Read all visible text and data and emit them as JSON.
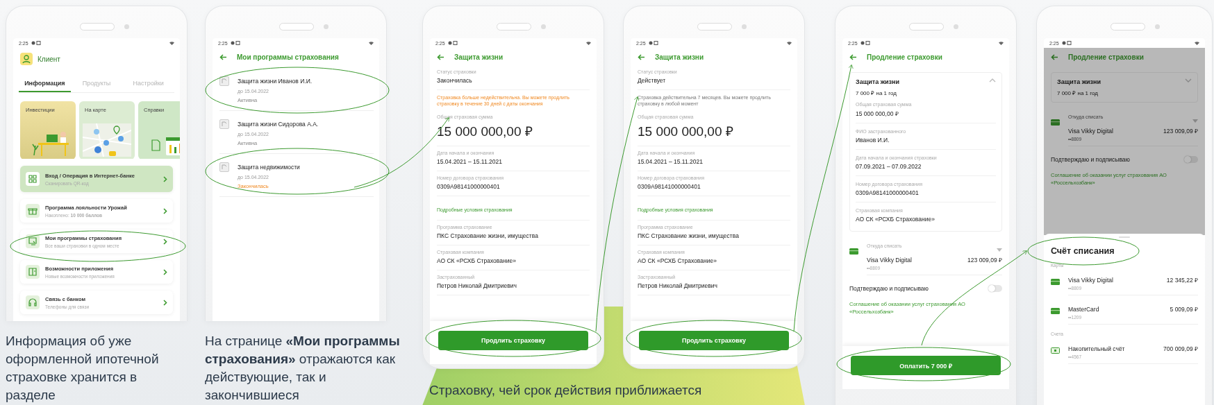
{
  "phones": [
    {
      "kind": "home",
      "time": "2:25",
      "user": "Клиент",
      "tabs": [
        {
          "label": "Информация",
          "selected": true
        },
        {
          "label": "Продукты",
          "selected": false
        },
        {
          "label": "Настройки",
          "selected": false
        }
      ],
      "tiles": [
        {
          "kind": "illustration",
          "title": "Инвестиции"
        },
        {
          "kind": "map",
          "title": "На карте"
        },
        {
          "kind": "documents",
          "title": "Справки"
        }
      ],
      "menu": [
        {
          "title": "Вход / Операция в Интернет-банке",
          "subtitle": "Сканировать QR-код",
          "highlighted": true
        },
        {
          "title": "Программа лояльности Урожай",
          "subtitle": "Накоплено: **10 000 баллов**",
          "highlighted": false
        },
        {
          "title": "Мои программы страхования",
          "subtitle": "Все ваши страховки в одном месте",
          "highlighted": false
        },
        {
          "title": "Возможности приложения",
          "subtitle": "Новые возможности приложения",
          "highlighted": false
        },
        {
          "title": "Связь с банком",
          "subtitle": "Телефоны для связи",
          "highlighted": false
        }
      ]
    },
    {
      "kind": "list",
      "time": "2:25",
      "title": "Мои программы страхования",
      "items": [
        {
          "title": "Защита жизни Иванов И.И.",
          "date": "до 15.04.2022",
          "status": "Активна",
          "expired": false
        },
        {
          "title": "Защита жизни Сидорова А.А.",
          "date": "до 15.04.2022",
          "status": "Активна",
          "expired": false
        },
        {
          "title": "Защита недвижимости",
          "date": "до 15.04.2022",
          "status": "Закончилась",
          "expired": true
        }
      ]
    },
    {
      "kind": "details",
      "time": "2:25",
      "title": "Защита жизни",
      "fields": [
        {
          "kind": "field",
          "label": "Статус страховки",
          "value": "Закончилась"
        },
        {
          "kind": "note",
          "text": "Страховка больше недействительна. Вы можете продлить страховку в течение 30 дней с даты окончания",
          "warning": true
        },
        {
          "kind": "amount",
          "label": "Общая страховая сумма",
          "value": "15 000 000,00 ₽"
        },
        {
          "kind": "field",
          "label": "Дата начала и окончания",
          "value": "15.04.2021 – 15.11.2021"
        },
        {
          "kind": "field",
          "label": "Номер договора страхования",
          "value": "0309A98141000000401"
        },
        {
          "kind": "link",
          "text": "Подробные условия страхования"
        },
        {
          "kind": "field",
          "label": "Программа страхование",
          "value": "ПКС Страхование жизни, имущества"
        },
        {
          "kind": "field",
          "label": "Страховая компания",
          "value": "АО СК «РСХБ Страхование»"
        },
        {
          "kind": "field",
          "label": "Застрахованный",
          "value": "Петров Николай Дмитриевич"
        }
      ],
      "button": "Продлить страховку"
    },
    {
      "kind": "details",
      "time": "2:25",
      "title": "Защита жизни",
      "fields": [
        {
          "kind": "field",
          "label": "Статус страховки",
          "value": "Действует"
        },
        {
          "kind": "note",
          "text": "Страховка действительна 7 месяцев. Вы можете продлить страховку в любой момент",
          "warning": false
        },
        {
          "kind": "amount",
          "label": "Общая страховая сумма",
          "value": "15 000 000,00 ₽"
        },
        {
          "kind": "field",
          "label": "Дата начала и окончания",
          "value": "15.04.2021 – 15.11.2021"
        },
        {
          "kind": "field",
          "label": "Номер договора страхования",
          "value": "0309A98141000000401"
        },
        {
          "kind": "link",
          "text": "Подробные условия страхования"
        },
        {
          "kind": "field",
          "label": "Программа страхование",
          "value": "ПКС Страхование жизни, имущества"
        },
        {
          "kind": "field",
          "label": "Страховая компания",
          "value": "АО СК «РСХБ Страхование»"
        },
        {
          "kind": "field",
          "label": "Застрахованный",
          "value": "Петров Николай Дмитриевич"
        }
      ],
      "button": "Продлить страховку"
    },
    {
      "kind": "renewal",
      "time": "2:25",
      "title": "Продление страховки",
      "policy": {
        "title": "Защита жизни",
        "subtitle": "7 000 ₽ на 1 год",
        "expanded": true,
        "fields": [
          {
            "label": "Общая страховая сумма",
            "value": "15 000 000,00 ₽"
          },
          {
            "label": "ФИО застрахованного",
            "value": "Иванов И.И."
          },
          {
            "label": "Дата начала и окончания страховки",
            "value": "07.09.2021 – 07.09.2022"
          },
          {
            "label": "Номер договора страхования",
            "value": "0309A98141000000401"
          },
          {
            "label": "Страховая компания",
            "value": "АО СК «РСХБ Страхование»"
          }
        ]
      },
      "source": {
        "label": "Откуда списать",
        "name": "Visa Vikky Digital",
        "amount": "123 009,09 ₽",
        "mask": "••8809"
      },
      "consent": {
        "label": "Подтверждаю и подписываю",
        "on": false
      },
      "agreement": "Соглашение об оказании услуг страхования АО «Россельхозбанк»",
      "button": "Оплатить 7 000 ₽"
    },
    {
      "kind": "renewal",
      "time": "2:25",
      "title": "Продление страховки",
      "policy": {
        "title": "Защита жизни",
        "subtitle": "7 000 ₽ на 1 год",
        "expanded": false
      },
      "source": {
        "label": "Откуда списать",
        "name": "Visa Vikky Digital",
        "amount": "123 009,09 ₽",
        "mask": "••8809"
      },
      "consent": {
        "label": "Подтверждаю и подписываю",
        "on": false
      },
      "agreement": "Соглашение об оказании услуг страхования АО «Россельхозбанк»",
      "sheet": {
        "title": "Счёт списания",
        "groups": [
          {
            "title": "Карты",
            "items": [
              {
                "kind": "card",
                "name": "Visa Vikky Digital",
                "amount": "12 345,22 ₽",
                "mask": "••8809"
              },
              {
                "kind": "card",
                "name": "MasterCard",
                "amount": "5 009,09 ₽",
                "mask": "••1209"
              }
            ]
          },
          {
            "title": "Счета",
            "items": [
              {
                "kind": "account",
                "name": "Накопительный счёт",
                "amount": "700 009,09 ₽",
                "mask": "••4567"
              }
            ]
          }
        ]
      }
    }
  ],
  "captions": [
    "Информация об уже оформленной ипотечной страховке хранится в разделе",
    "На странице **«Мои программы страхования»** отражаются как действующие, так и закончившиеся",
    "Страховку, чей срок действия приближается"
  ]
}
